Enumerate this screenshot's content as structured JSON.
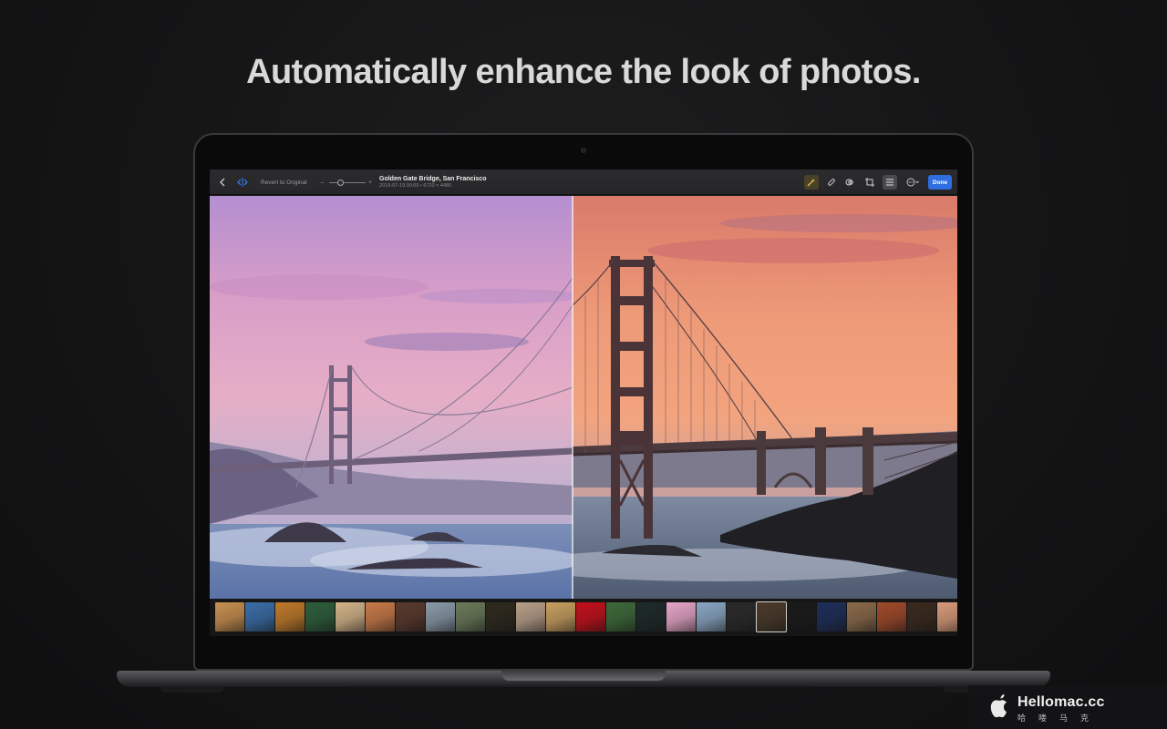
{
  "headline": "Automatically enhance the look of photos.",
  "toolbar": {
    "back_icon": "chevron-left-icon",
    "compare_icon": "split-compare-icon",
    "revert_label": "Revert to Original",
    "slider_minus": "−",
    "slider_plus": "+",
    "photo_title": "Golden Gate Bridge, San Francisco",
    "photo_subtitle": "2019-07-19 00:00 • 6720 × 4480",
    "tools": [
      "magic-wand-icon",
      "bandage-icon",
      "filter-icon",
      "crop-icon",
      "adjust-list-icon",
      "more-icon"
    ],
    "done_label": "Done",
    "accent": "#2f6ee0"
  },
  "photo": {
    "subject": "golden-gate-bridge-sunset",
    "comparison": "before-after-split"
  },
  "filmstrip": {
    "thumb_colors": [
      "#c89050",
      "#3a6ea8",
      "#c07a2a",
      "#2e5e3c",
      "#d4b48a",
      "#c87a4a",
      "#5a3a2e",
      "#8a9aa8",
      "#6a7a5a",
      "#2e2a1e",
      "#b8a08a",
      "#c9a060",
      "#c4101c",
      "#3e6a3a",
      "#1e2a2a",
      "#e7a6c8",
      "#8aa6c4",
      "#2a2a2a",
      "#4a3a2a",
      "#1a1a1a",
      "#1e2e5a",
      "#8a6a4a",
      "#a04a2a",
      "#3a2a1e",
      "#d89a7a",
      "#4a3ea8"
    ],
    "selected_index": 18
  },
  "watermark": {
    "name": "Hellomac.cc",
    "sub": "哈喽马克"
  }
}
